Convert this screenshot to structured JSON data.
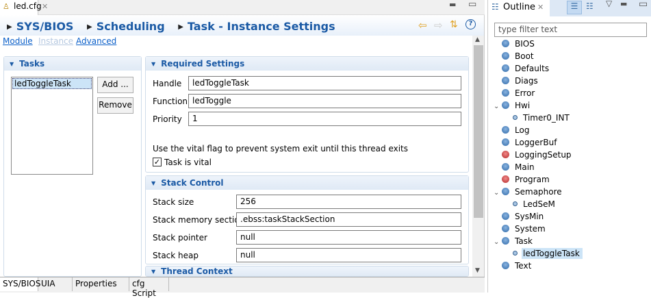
{
  "editor": {
    "tab_label": "led.cfg",
    "breadcrumb": [
      "SYS/BIOS",
      "Scheduling",
      "Task - Instance Settings"
    ],
    "links": {
      "module": "Module",
      "instance": "Instance",
      "advanced": "Advanced"
    },
    "tasks": {
      "title": "Tasks",
      "items": [
        "ledToggleTask"
      ],
      "add_label": "Add ...",
      "remove_label": "Remove"
    },
    "required": {
      "title": "Required Settings",
      "handle_label": "Handle",
      "handle": "ledToggleTask",
      "function_label": "Function",
      "function": "ledToggle",
      "priority_label": "Priority",
      "priority": "1",
      "vital_hint": "Use the vital flag to prevent system exit until this thread exits",
      "vital_label": "Task is vital",
      "vital_checked": true
    },
    "stack": {
      "title": "Stack Control",
      "size_label": "Stack size",
      "size": "256",
      "section_label": "Stack memory section",
      "section": ".ebss:taskStackSection",
      "pointer_label": "Stack pointer",
      "pointer": "null",
      "heap_label": "Stack heap",
      "heap": "null"
    },
    "thread": {
      "title": "Thread Context"
    },
    "bottom_tabs": [
      "SYS/BIOS",
      "UIA",
      "Properties",
      "cfg Script"
    ]
  },
  "outline": {
    "title": "Outline",
    "filter_placeholder": "type filter text",
    "items": [
      {
        "label": "BIOS",
        "level": 0,
        "color": "blue"
      },
      {
        "label": "Boot",
        "level": 0,
        "color": "blue"
      },
      {
        "label": "Defaults",
        "level": 0,
        "color": "blue"
      },
      {
        "label": "Diags",
        "level": 0,
        "color": "blue"
      },
      {
        "label": "Error",
        "level": 0,
        "color": "blue"
      },
      {
        "label": "Hwi",
        "level": 0,
        "color": "blue",
        "expanded": true
      },
      {
        "label": "Timer0_INT",
        "level": 1
      },
      {
        "label": "Log",
        "level": 0,
        "color": "blue"
      },
      {
        "label": "LoggerBuf",
        "level": 0,
        "color": "blue"
      },
      {
        "label": "LoggingSetup",
        "level": 0,
        "color": "red"
      },
      {
        "label": "Main",
        "level": 0,
        "color": "blue"
      },
      {
        "label": "Program",
        "level": 0,
        "color": "red"
      },
      {
        "label": "Semaphore",
        "level": 0,
        "color": "blue",
        "expanded": true
      },
      {
        "label": "LedSeM",
        "level": 1
      },
      {
        "label": "SysMin",
        "level": 0,
        "color": "blue"
      },
      {
        "label": "System",
        "level": 0,
        "color": "blue"
      },
      {
        "label": "Task",
        "level": 0,
        "color": "blue",
        "expanded": true
      },
      {
        "label": "ledToggleTask",
        "level": 1,
        "selected": true
      },
      {
        "label": "Text",
        "level": 0,
        "color": "blue"
      }
    ]
  }
}
